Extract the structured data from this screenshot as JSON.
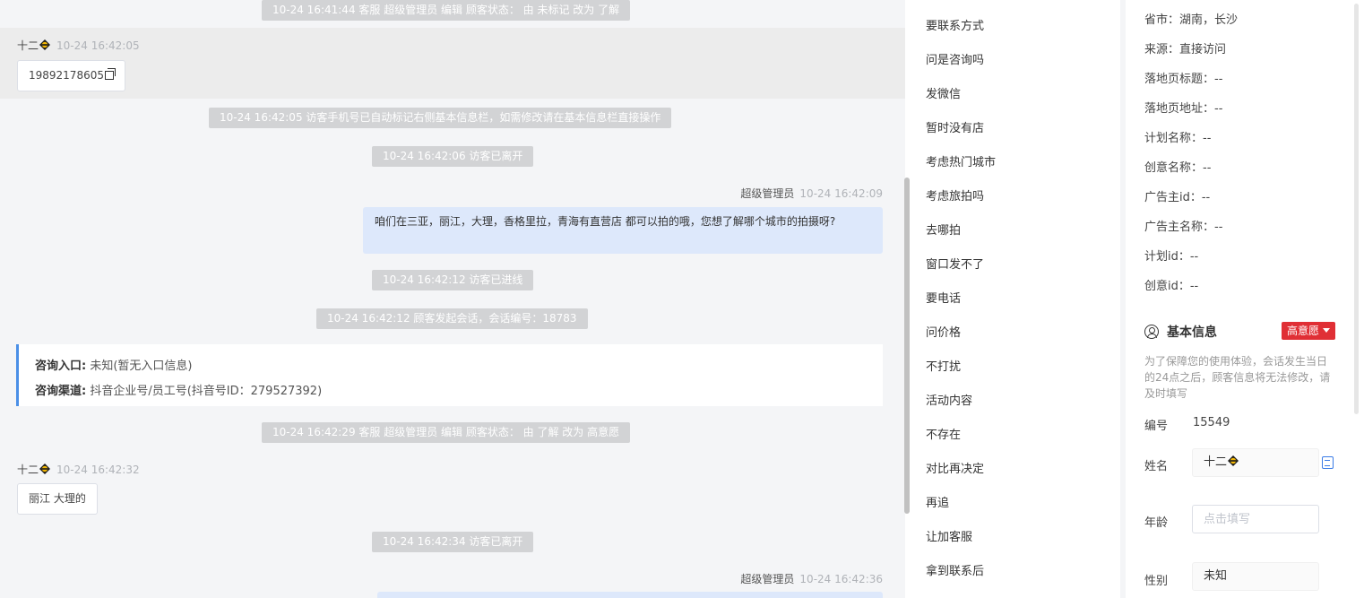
{
  "chat": {
    "system_messages": [
      "10-24 16:41:44 客服 超级管理员 编辑 顾客状态： 由 未标记 改为 了解",
      "10-24 16:42:05 访客手机号已自动标记右侧基本信息栏，如需修改请在基本信息栏直接操作",
      "10-24 16:42:06 访客已离开",
      "10-24 16:42:12 访客已进线",
      "10-24 16:42:12 顾客发起会话，会话编号：18783",
      "10-24 16:42:29 客服 超级管理员 编辑 顾客状态： 由 了解 改为 高意愿",
      "10-24 16:42:34 访客已离开"
    ],
    "visitor_messages": [
      {
        "name": "十二",
        "time": "10-24 16:42:05",
        "text": "19892178605"
      },
      {
        "name": "十二",
        "time": "10-24 16:42:32",
        "text": "丽江 大理的"
      }
    ],
    "agent_messages": [
      {
        "name": "超级管理员",
        "time": "10-24 16:42:09",
        "text": "咱们在三亚，丽江，大理，香格里拉，青海有直营店 都可以拍的哦，您想了解哪个城市的拍摄呀?"
      },
      {
        "name": "超级管理员",
        "time": "10-24 16:42:36",
        "text": ""
      }
    ],
    "info_card": {
      "entry_label": "咨询入口:",
      "entry_value": "未知(暂无入口信息)",
      "channel_label": "咨询渠道:",
      "channel_value": "抖音企业号/员工号(抖音号ID：279527392)"
    }
  },
  "quick_replies": [
    "要联系方式",
    "问是咨询吗",
    "发微信",
    "暂时没有店",
    "考虑热门城市",
    "考虑旅拍吗",
    "去哪拍",
    "窗口发不了",
    "要电话",
    "问价格",
    "不打扰",
    "活动内容",
    "不存在",
    "对比再决定",
    "再追",
    "让加客服",
    "拿到联系后"
  ],
  "panel": {
    "fields": [
      "省市：湖南，长沙",
      "来源：直接访问",
      "落地页标题：--",
      "落地页地址：--",
      "计划名称：--",
      "创意名称：--",
      "广告主id：--",
      "广告主名称：--",
      "计划id：--",
      "创意id：--"
    ],
    "section_title": "基本信息",
    "badge": "高意愿",
    "note": "为了保障您的使用体验，会话发生当日的24点之后，顾客信息将无法修改，请及时填写",
    "id_label": "编号",
    "id_value": "15549",
    "name_label": "姓名",
    "name_value": "十二",
    "age_label": "年龄",
    "age_placeholder": "点击填写",
    "gender_label": "性别",
    "gender_value": "未知"
  },
  "colors": {
    "accent": "#4a8fe7",
    "badge": "#e02f35",
    "agent_bubble": "#dde8fb",
    "system_bg": "#d2d3d5"
  }
}
